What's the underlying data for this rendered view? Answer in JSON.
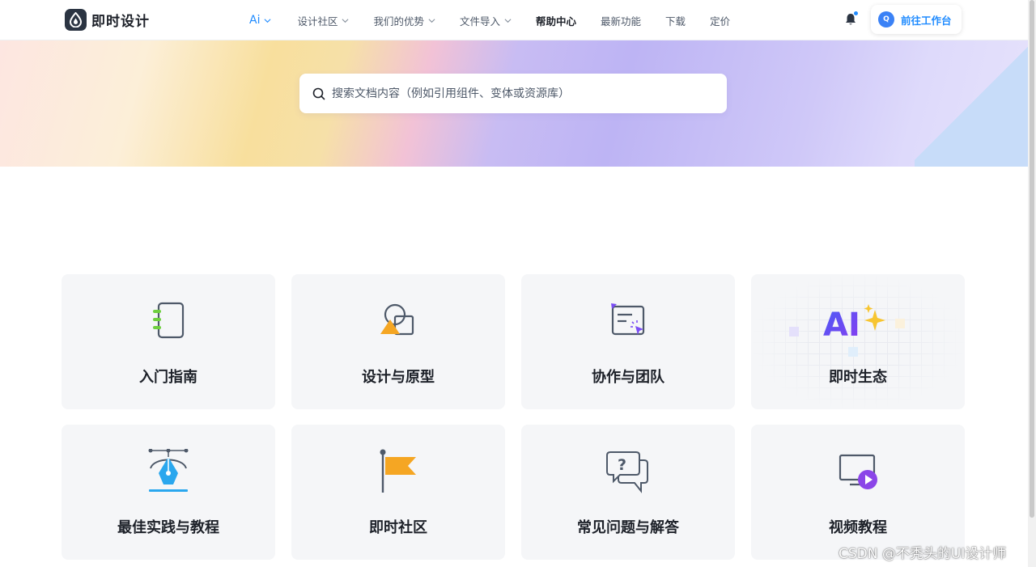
{
  "brand": {
    "name": "即时设计"
  },
  "nav": {
    "ai_label": "Ai",
    "items": [
      {
        "label": "设计社区"
      },
      {
        "label": "我们的优势"
      },
      {
        "label": "文件导入"
      },
      {
        "label": "帮助中心"
      },
      {
        "label": "最新功能"
      },
      {
        "label": "下载"
      },
      {
        "label": "定价"
      }
    ]
  },
  "header": {
    "workspace_button": "前往工作台",
    "avatar_letter": "Q"
  },
  "search": {
    "placeholder": "搜索文档内容（例如引用组件、变体或资源库）"
  },
  "cards": [
    {
      "label": "入门指南",
      "icon": "notebook-icon"
    },
    {
      "label": "设计与原型",
      "icon": "shapes-icon"
    },
    {
      "label": "协作与团队",
      "icon": "collaboration-icon"
    },
    {
      "label": "即时生态",
      "icon": "ai-sparkle-icon",
      "icon_text": "AI"
    },
    {
      "label": "最佳实践与教程",
      "icon": "pen-tool-icon"
    },
    {
      "label": "即时社区",
      "icon": "flag-icon"
    },
    {
      "label": "常见问题与解答",
      "icon": "question-chat-icon"
    },
    {
      "label": "视频教程",
      "icon": "video-play-icon"
    }
  ],
  "watermark": "CSDN @不秃头的UI设计师",
  "colors": {
    "accent": "#1f8bff",
    "card_bg": "#f5f6f8",
    "orange": "#f5a623",
    "purple": "#7b4df5",
    "green": "#6fcf3f",
    "blue": "#2aa7ee"
  }
}
